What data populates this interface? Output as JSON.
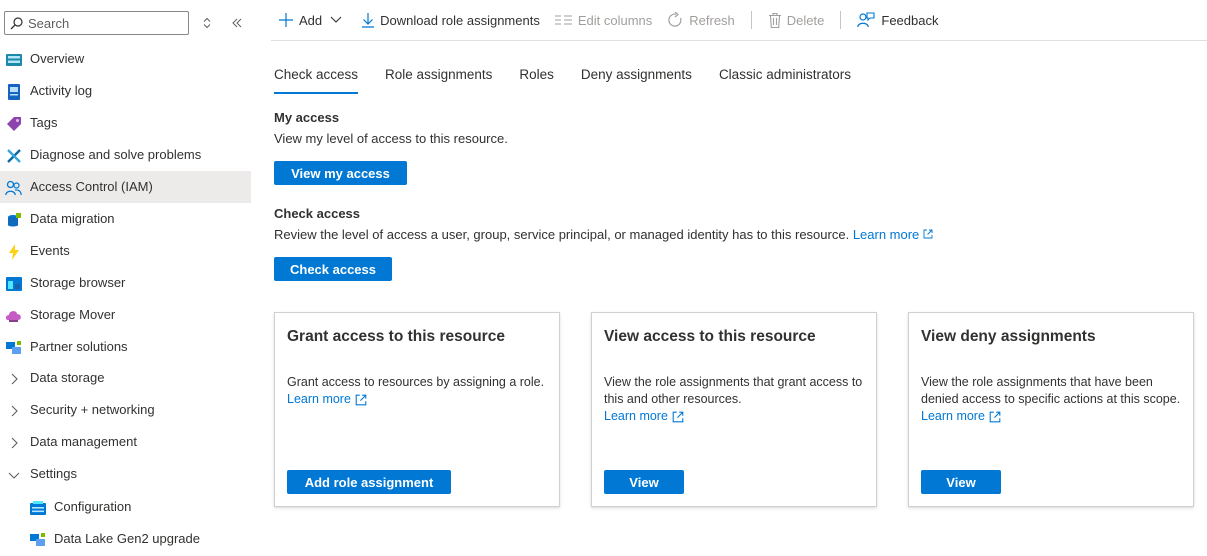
{
  "sidebar": {
    "search_placeholder": "Search",
    "items": [
      {
        "label": "Overview"
      },
      {
        "label": "Activity log"
      },
      {
        "label": "Tags"
      },
      {
        "label": "Diagnose and solve problems"
      },
      {
        "label": "Access Control (IAM)"
      },
      {
        "label": "Data migration"
      },
      {
        "label": "Events"
      },
      {
        "label": "Storage browser"
      },
      {
        "label": "Storage Mover"
      },
      {
        "label": "Partner solutions"
      },
      {
        "label": "Data storage"
      },
      {
        "label": "Security + networking"
      },
      {
        "label": "Data management"
      },
      {
        "label": "Settings"
      },
      {
        "label": "Configuration"
      },
      {
        "label": "Data Lake Gen2 upgrade"
      }
    ]
  },
  "toolbar": {
    "add": "Add",
    "download": "Download role assignments",
    "edit_columns": "Edit columns",
    "refresh": "Refresh",
    "delete": "Delete",
    "feedback": "Feedback"
  },
  "tabs": [
    {
      "label": "Check access"
    },
    {
      "label": "Role assignments"
    },
    {
      "label": "Roles"
    },
    {
      "label": "Deny assignments"
    },
    {
      "label": "Classic administrators"
    }
  ],
  "my_access": {
    "title": "My access",
    "desc": "View my level of access to this resource.",
    "button": "View my access"
  },
  "check_access": {
    "title": "Check access",
    "desc": "Review the level of access a user, group, service principal, or managed identity has to this resource.",
    "learn_more": "Learn more",
    "button": "Check access"
  },
  "cards": [
    {
      "title": "Grant access to this resource",
      "desc": "Grant access to resources by assigning a role.",
      "learn_more": "Learn more",
      "button": "Add role assignment"
    },
    {
      "title": "View access to this resource",
      "desc": "View the role assignments that grant access to this and other resources.",
      "learn_more": "Learn more",
      "button": "View"
    },
    {
      "title": "View deny assignments",
      "desc": "View the role assignments that have been denied access to specific actions at this scope.",
      "learn_more": "Learn more",
      "button": "View"
    }
  ],
  "colors": {
    "accent": "#0078d4",
    "active_nav_bg": "#edebe9",
    "text": "#323130",
    "disabled": "#a19f9d"
  }
}
